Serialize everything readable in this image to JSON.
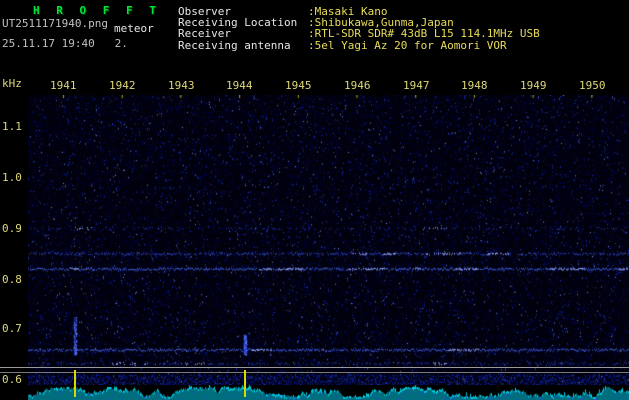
{
  "header": {
    "app_title": "H R O F F T",
    "filename": "UT2511171940.png",
    "annotation": "meteor",
    "timestamp_line": "25.11.17 19:40   2.",
    "info_rows": [
      {
        "label": "Observer",
        "value": ":Masaki Kano"
      },
      {
        "label": "Receiving Location",
        "value": ":Shibukawa,Gunma,Japan"
      },
      {
        "label": "Receiver",
        "value": ":RTL-SDR SDR# 43dB L15 114.1MHz USB"
      },
      {
        "label": "Receiving antenna",
        "value": ":5el Yagi Az 20 for Aomori VOR"
      }
    ]
  },
  "chart_data": {
    "type": "heatmap",
    "subtype": "radio-meteor-spectrogram",
    "title": "HROFFT 10-minute meteor radio spectrogram, 25.11.17 19:40 UT",
    "x_axis": {
      "tick_labels": [
        "1941",
        "1942",
        "1943",
        "1944",
        "1945",
        "1946",
        "1947",
        "1948",
        "1949",
        "1950"
      ],
      "start_time": "19:40",
      "end_time": "19:50"
    },
    "y_axis": {
      "unit": "kHz",
      "tick_labels": [
        "1.1",
        "1.0",
        "0.9",
        "0.8",
        "0.7",
        "0.6"
      ],
      "top_khz": 1.163,
      "bottom_khz": 0.59
    },
    "carrier_lines": [
      {
        "khz": 0.9,
        "density": 0.3,
        "color": "#1c2c96"
      },
      {
        "khz": 0.85,
        "density": 0.7,
        "color": "#3048cc"
      },
      {
        "khz": 0.82,
        "density": 0.88,
        "color": "#4a68f0"
      },
      {
        "khz": 0.66,
        "density": 0.88,
        "color": "#4a68f0"
      },
      {
        "khz": 0.633,
        "density": 0.4,
        "color": "#2838ae"
      }
    ],
    "echo_events": [
      {
        "x_fraction": 0.078,
        "khz_top": 0.725,
        "khz_bottom": 0.65
      },
      {
        "x_fraction": 0.361,
        "khz_top": 0.69,
        "khz_bottom": 0.65
      }
    ],
    "event_marker_x_fractions": [
      0.078,
      0.361
    ],
    "bottom_strip": "signal level waveform",
    "colors": {
      "background": "#01010d",
      "noise_dim": "#000078",
      "noise_mid": "#0a1eb4",
      "noise_bright": "#2846e6",
      "noise_peak": "#8ca0ff",
      "axis_text": "#ded87a",
      "title_green": "#00e43c",
      "value_yellow": "#e8dc5a",
      "label_white": "#e6e6e6",
      "marker_yellow": "#d8d800",
      "strip_teal": "#006e7c",
      "strip_cyan": "#00d2e6",
      "separator_gray": "#9a9a9a"
    }
  }
}
